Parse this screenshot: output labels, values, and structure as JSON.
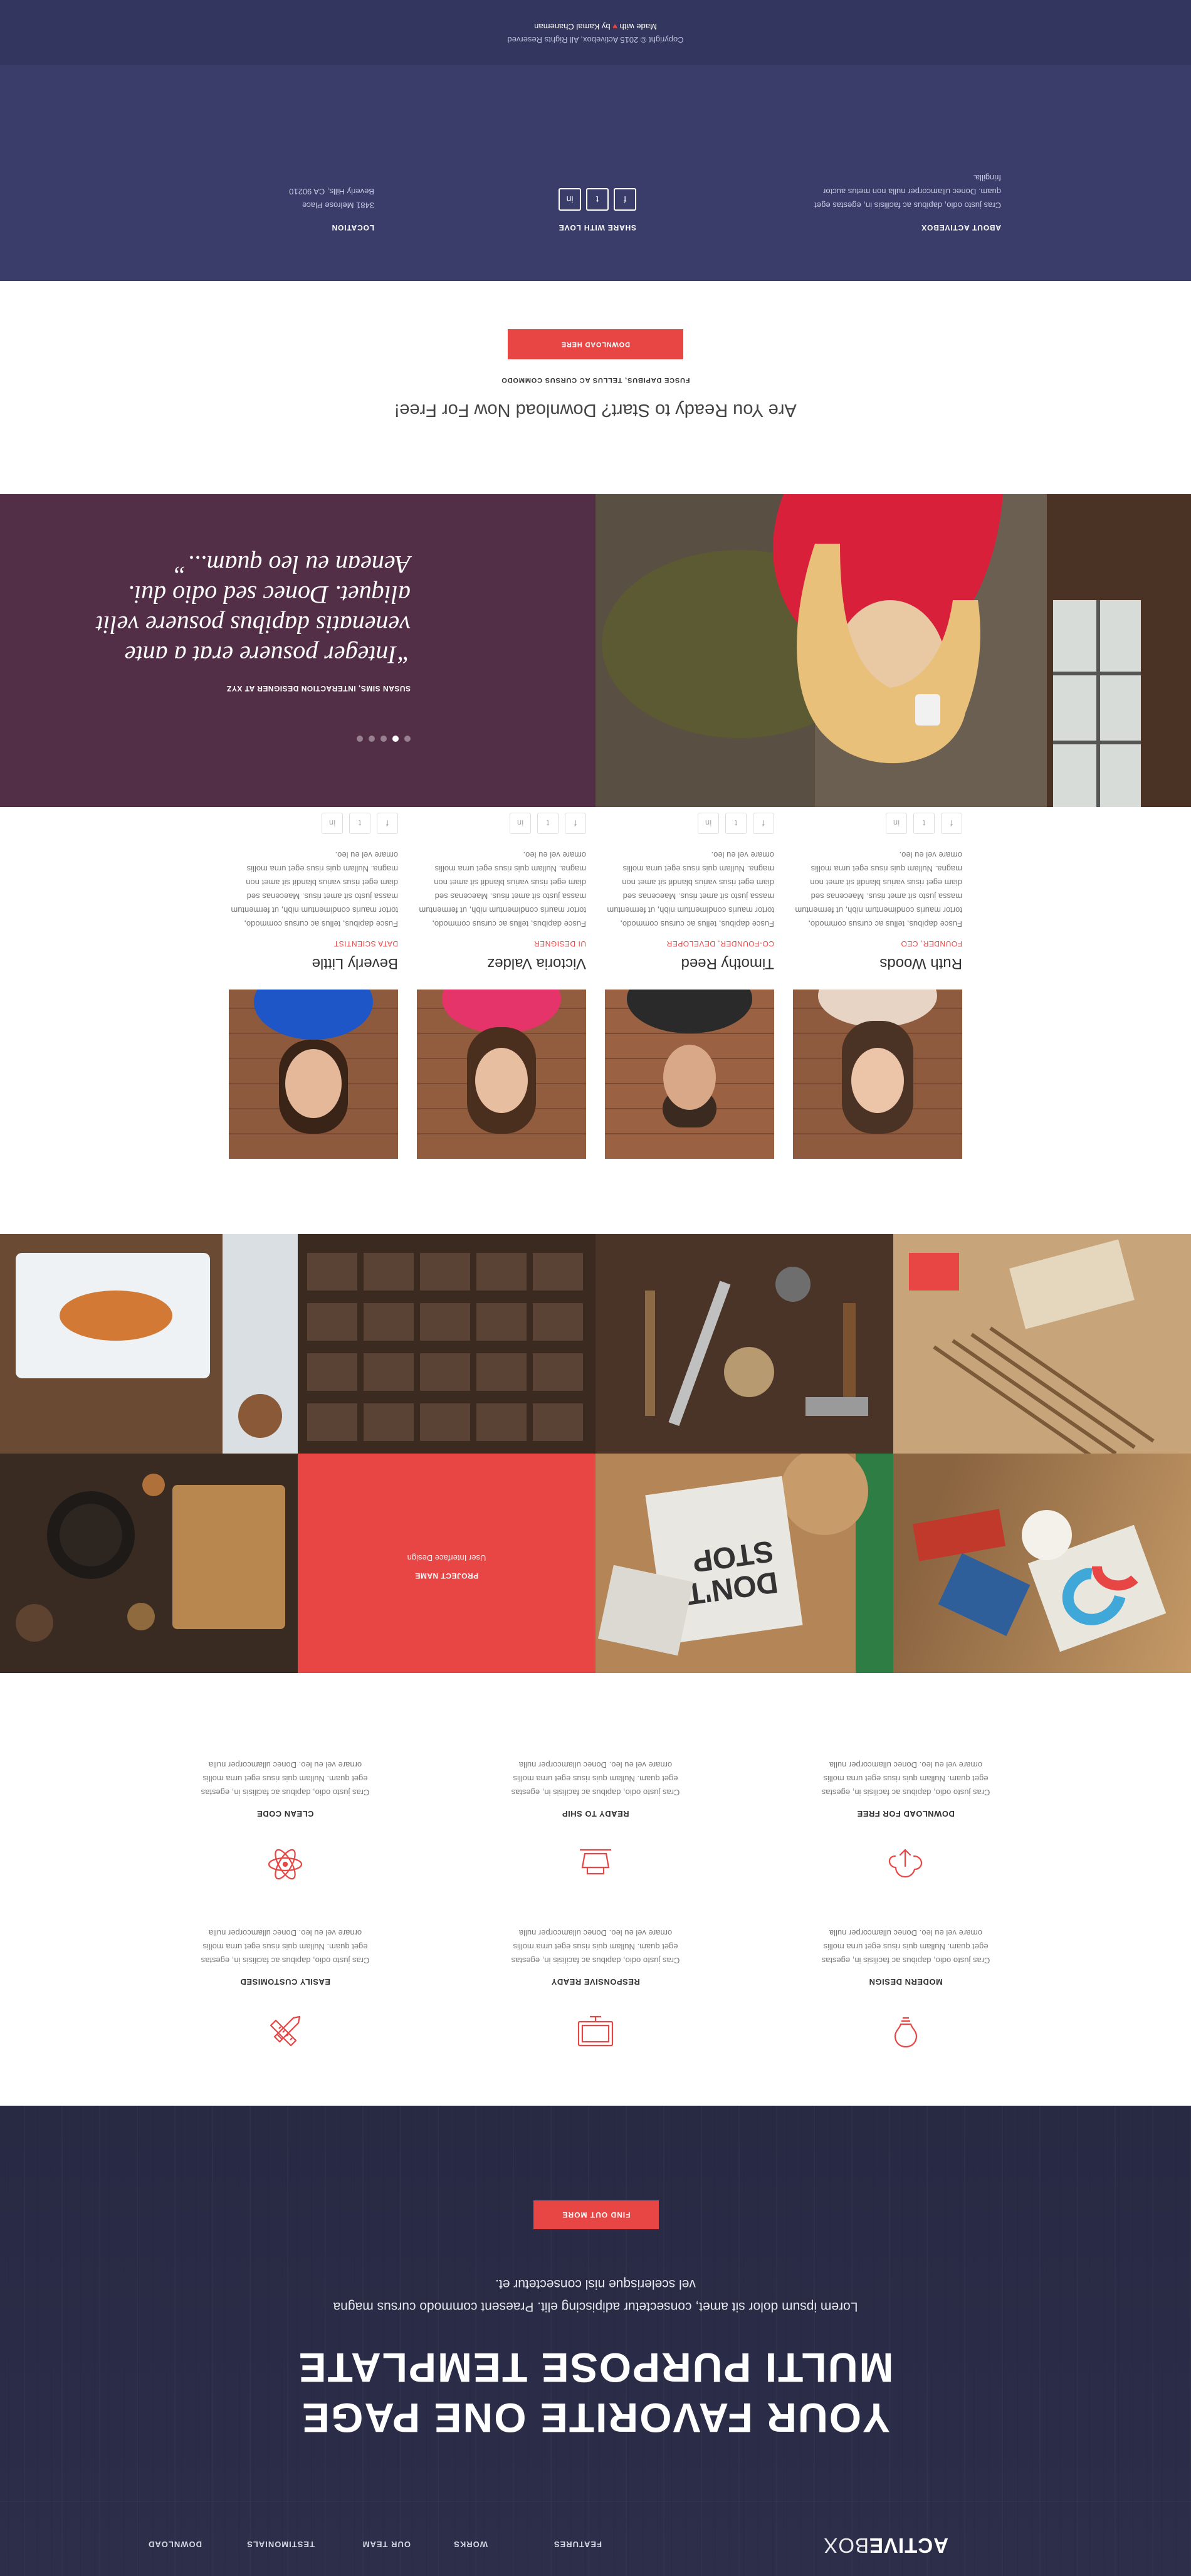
{
  "nav": {
    "logo_bold": "ACTIVE",
    "logo_light": "BOX",
    "links": [
      "FEATURES",
      "WORKS",
      "OUR TEAM",
      "TESTIMONIALS",
      "DOWNLOAD"
    ]
  },
  "hero": {
    "title_line1": "YOUR FAVORITE ONE PAGE",
    "title_line2": "MULTI PURPOSE TEMPLATE",
    "subtitle_line1": "Lorem ipsum dolor sit amet, consectetur adipiscing elit. Praesent commodo cursus magna",
    "subtitle_line2": "vel scelerisque nisl consectetur et.",
    "button_label": "FIND OUT MORE"
  },
  "features": {
    "items": [
      {
        "title": "EASILY CUSTOMISED",
        "icon": "pencil-ruler-icon",
        "text": "Cras justo odio, dapibus ac facilisis in, egestas eget quam. Nullam quis risus eget urna mollis ornare vel eu leo. Donec ullamcorper nulla"
      },
      {
        "title": "RESPONSIVE READY",
        "icon": "responsive-devices-icon",
        "text": "Cras justo odio, dapibus ac facilisis in, egestas eget quam. Nullam quis risus eget urna mollis ornare vel eu leo. Donec ullamcorper nulla"
      },
      {
        "title": "MODERN DESIGN",
        "icon": "lightbulb-icon",
        "text": "Cras justo odio, dapibus ac facilisis in, egestas eget quam. Nullam quis risus eget urna mollis ornare vel eu leo. Donec ullamcorper nulla"
      },
      {
        "title": "CLEAN CODE",
        "icon": "atom-icon",
        "text": "Cras justo odio, dapibus ac facilisis in, egestas eget quam. Nullam quis risus eget urna mollis ornare vel eu leo. Donec ullamcorper nulla"
      },
      {
        "title": "READY TO SHIP",
        "icon": "ship-box-icon",
        "text": "Cras justo odio, dapibus ac facilisis in, egestas eget quam. Nullam quis risus eget urna mollis ornare vel eu leo. Donec ullamcorper nulla"
      },
      {
        "title": "DOWNLOAD FOR FREE",
        "icon": "cloud-download-icon",
        "text": "Cras justo odio, dapibus ac facilisis in, egestas eget quam. Nullam quis risus eget urna mollis ornare vel eu leo. Donec ullamcorper nulla"
      }
    ]
  },
  "works": {
    "overlay_title": "PROJECT NAME",
    "overlay_subtitle": "User Interface Design"
  },
  "team": {
    "members": [
      {
        "name": "Beverly Little",
        "role": "DATA SCIENTIST",
        "bio": "Fusce dapibus, tellus ac cursus commodo, tortor mauris condimentum nibh, ut fermentum massa justo sit amet risus. Maecenas sed diam eget risus varius blandit sit amet non magna. Nullam quis risus eget urna mollis ornare vel eu leo."
      },
      {
        "name": "Victoria Valdez",
        "role": "UI DESIGNER",
        "bio": "Fusce dapibus, tellus ac cursus commodo, tortor mauris condimentum nibh, ut fermentum massa justo sit amet risus. Maecenas sed diam eget risus varius blandit sit amet non magna. Nullam quis risus eget urna mollis ornare vel eu leo."
      },
      {
        "name": "Timothy Reed",
        "role": "CO-FOUNDER, DEVELOPER",
        "bio": "Fusce dapibus, tellus ac cursus commodo, tortor mauris condimentum nibh, ut fermentum massa justo sit amet risus. Maecenas sed diam eget risus varius blandit sit amet non magna. Nullam quis risus eget urna mollis ornare vel eu leo."
      },
      {
        "name": "Ruth Woods",
        "role": "FOUNDER, CEO",
        "bio": "Fusce dapibus, tellus ac cursus commodo, tortor mauris condimentum nibh, ut fermentum massa justo sit amet risus. Maecenas sed diam eget risus varius blandit sit amet non magna. Nullam quis risus eget urna mollis ornare vel eu leo."
      }
    ]
  },
  "testimonial": {
    "quote": "“Integer posuere erat a ante venenatis dapibus posuere velit aliquet. Donec sed odio dui. Aenean eu leo quam...”",
    "author": "SUSAN SIMS, INTERACTION DESIGNER AT XYZ"
  },
  "cta": {
    "title": "Are You Ready to Start? Download Now For Free!",
    "tagline": "FUSCE DAPIBUS, TELLUS AC CURSUS COMMODO",
    "button_label": "DOWNLOAD HERE"
  },
  "footer": {
    "location_title": "LOCATION",
    "address_line1": "3481 Melrose Place",
    "address_line2": "Beverly Hills, CA 90210",
    "share_title": "SHARE WITH LOVE",
    "about_title": "ABOUT ACTIVEBOX",
    "about_text": "Cras justo odio, dapibus ac facilisis in, egestas eget quam. Donec ullamcorper nulla non metus auctor fringilla.",
    "copyright": "Copyright © 2015 Activebox, All Rights Reserved",
    "made_prefix": "Made with",
    "made_suffix": "by Kamal Chaneman"
  },
  "colors": {
    "accent": "#e84545",
    "hero_bg": "#2b2d47",
    "footer_bg": "#3a3d6a",
    "testimonial_bg": "#532e47"
  }
}
